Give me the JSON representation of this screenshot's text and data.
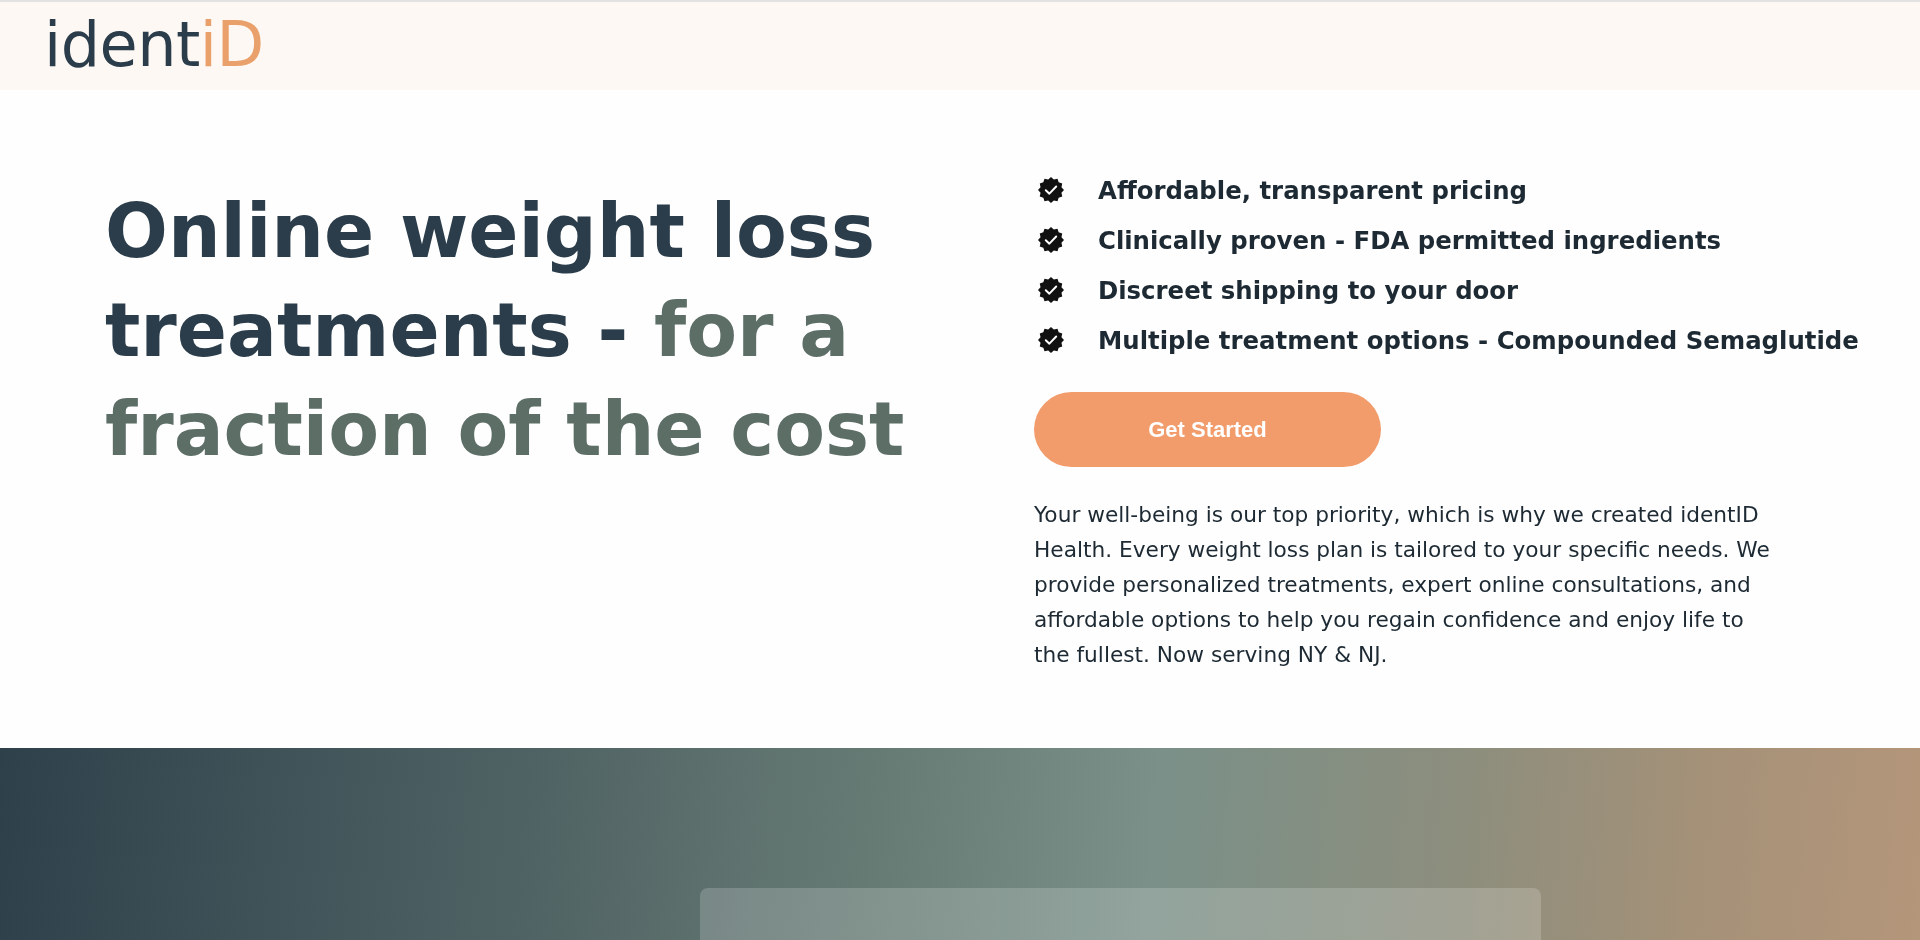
{
  "header": {
    "logo": {
      "main": "ident",
      "accent": "iD"
    }
  },
  "hero": {
    "headline": {
      "text": "Online weight loss treatments -",
      "accent": "for a fraction of the cost"
    },
    "features": [
      {
        "label": "Affordable, transparent pricing"
      },
      {
        "label": "Clinically proven - FDA permitted ingredients"
      },
      {
        "label": "Discreet shipping to your door"
      },
      {
        "label": "Multiple treatment options - Compounded Semaglutide"
      }
    ],
    "cta": {
      "label": "Get Started"
    },
    "description": "Your well-being is our top priority, which is why we created identID Health. Every weight loss plan is tailored to your specific needs. We provide personalized treatments, expert online consultations, and affordable options to help you regain confidence and enjoy life to the fullest. Now serving NY & NJ."
  }
}
